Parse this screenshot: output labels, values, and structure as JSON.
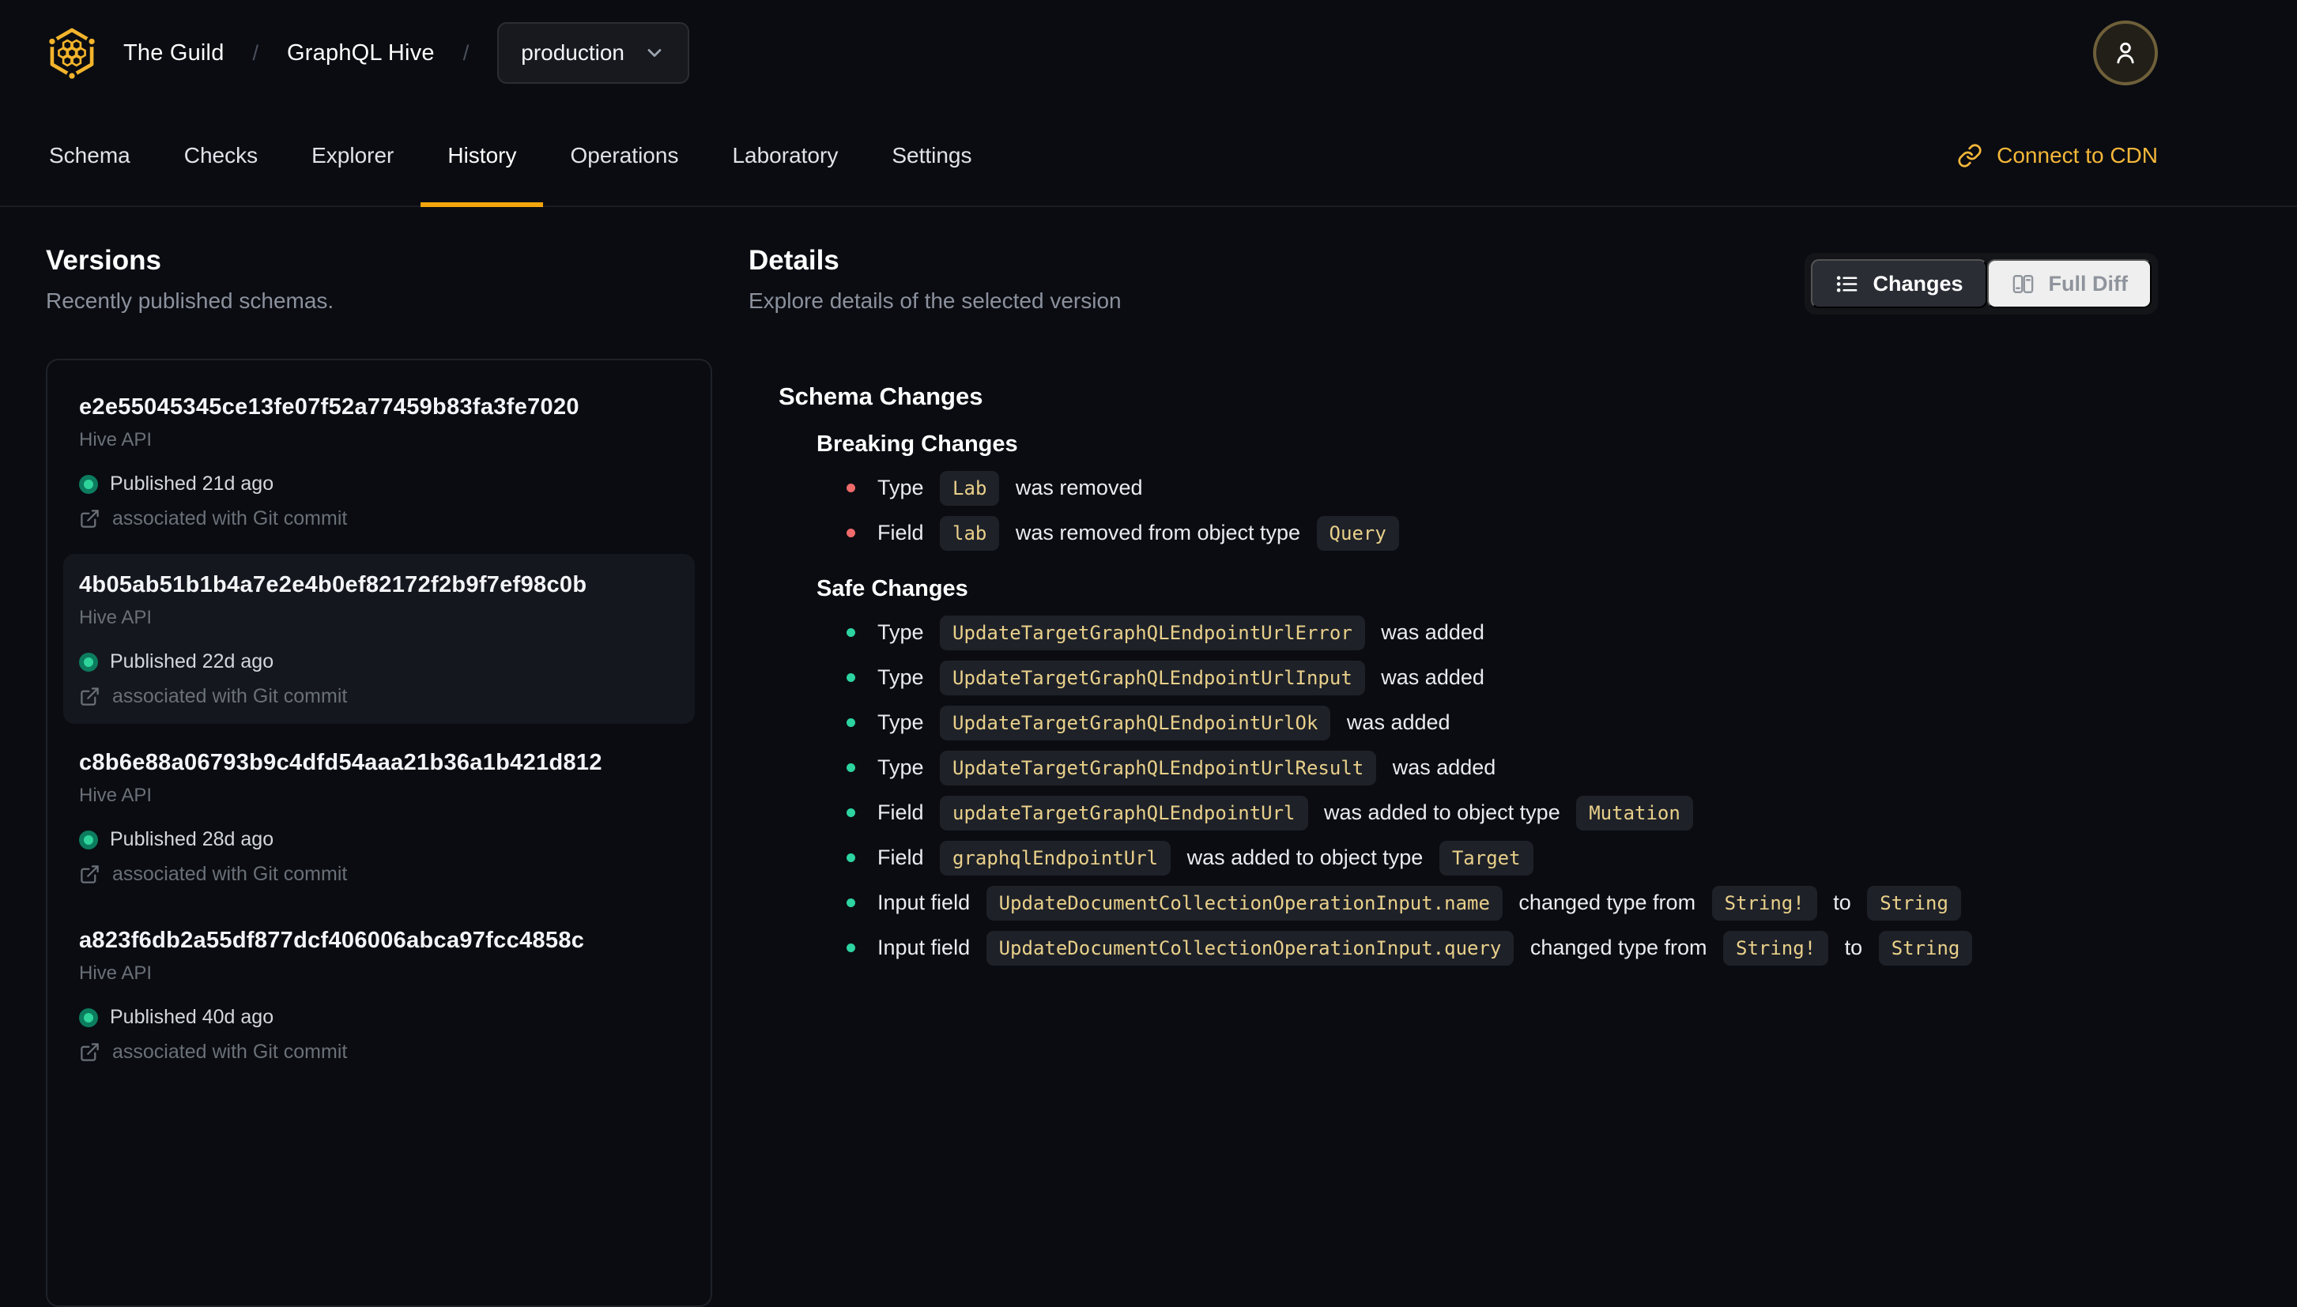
{
  "app": {
    "breadcrumb": {
      "org": "The Guild",
      "separator": "/",
      "project": "GraphQL Hive"
    },
    "target_selector": {
      "value": "production"
    },
    "tabs": {
      "items": [
        "Schema",
        "Checks",
        "Explorer",
        "History",
        "Operations",
        "Laboratory",
        "Settings"
      ],
      "active": "History"
    },
    "cdn_link_label": "Connect to CDN",
    "icons": {
      "logo": "hive-honeycomb-logo",
      "avatar": "user-icon",
      "cdn": "link-icon",
      "target_chevron": "chevron-down-icon"
    }
  },
  "versions_panel": {
    "title": "Versions",
    "subtitle": "Recently published schemas.",
    "items": [
      {
        "hash": "e2e55045345ce13fe07f52a77459b83fa3fe7020",
        "service": "Hive API",
        "published": "Published 21d ago",
        "git": "associated with Git commit",
        "selected": false
      },
      {
        "hash": "4b05ab51b1b4a7e2e4b0ef82172f2b9f7ef98c0b",
        "service": "Hive API",
        "published": "Published 22d ago",
        "git": "associated with Git commit",
        "selected": true
      },
      {
        "hash": "c8b6e88a06793b9c4dfd54aaa21b36a1b421d812",
        "service": "Hive API",
        "published": "Published 28d ago",
        "git": "associated with Git commit",
        "selected": false
      },
      {
        "hash": "a823f6db2a55df877dcf406006abca97fcc4858c",
        "service": "Hive API",
        "published": "Published 40d ago",
        "git": "associated with Git commit",
        "selected": false
      }
    ]
  },
  "details_panel": {
    "title": "Details",
    "subtitle": "Explore details of the selected version",
    "view_toggle": {
      "changes_label": "Changes",
      "full_diff_label": "Full Diff",
      "active": "Changes"
    },
    "schema_changes": {
      "title": "Schema Changes",
      "sections": [
        {
          "title": "Breaking Changes",
          "severity": "breaking",
          "items": [
            [
              {
                "text": "Type "
              },
              {
                "code": "Lab"
              },
              {
                "text": " was removed"
              }
            ],
            [
              {
                "text": "Field "
              },
              {
                "code": "lab"
              },
              {
                "text": " was removed from object type "
              },
              {
                "code": "Query"
              }
            ]
          ]
        },
        {
          "title": "Safe Changes",
          "severity": "safe",
          "items": [
            [
              {
                "text": "Type "
              },
              {
                "code": "UpdateTargetGraphQLEndpointUrlError"
              },
              {
                "text": " was added"
              }
            ],
            [
              {
                "text": "Type "
              },
              {
                "code": "UpdateTargetGraphQLEndpointUrlInput"
              },
              {
                "text": " was added"
              }
            ],
            [
              {
                "text": "Type "
              },
              {
                "code": "UpdateTargetGraphQLEndpointUrlOk"
              },
              {
                "text": " was added"
              }
            ],
            [
              {
                "text": "Type "
              },
              {
                "code": "UpdateTargetGraphQLEndpointUrlResult"
              },
              {
                "text": " was added"
              }
            ],
            [
              {
                "text": "Field "
              },
              {
                "code": "updateTargetGraphQLEndpointUrl"
              },
              {
                "text": " was added to object type "
              },
              {
                "code": "Mutation"
              }
            ],
            [
              {
                "text": "Field "
              },
              {
                "code": "graphqlEndpointUrl"
              },
              {
                "text": " was added to object type "
              },
              {
                "code": "Target"
              }
            ],
            [
              {
                "text": "Input field "
              },
              {
                "code": "UpdateDocumentCollectionOperationInput.name"
              },
              {
                "text": " changed type from "
              },
              {
                "code": "String!"
              },
              {
                "text": " to "
              },
              {
                "code": "String"
              }
            ],
            [
              {
                "text": "Input field "
              },
              {
                "code": "UpdateDocumentCollectionOperationInput.query"
              },
              {
                "text": " changed type from "
              },
              {
                "code": "String!"
              },
              {
                "text": " to "
              },
              {
                "code": "String"
              }
            ]
          ]
        }
      ]
    }
  },
  "colors": {
    "background": "#0a0c11",
    "accent_gold": "#f5b73a",
    "tab_underline": "#f2a50c",
    "breaking_bullet": "#ef6a6a",
    "safe_bullet": "#2dd4a0",
    "status_dot": "#2fd49b",
    "code_text": "#e9d08a",
    "code_background": "#1e2128",
    "selected_item_background": "#14171d"
  }
}
